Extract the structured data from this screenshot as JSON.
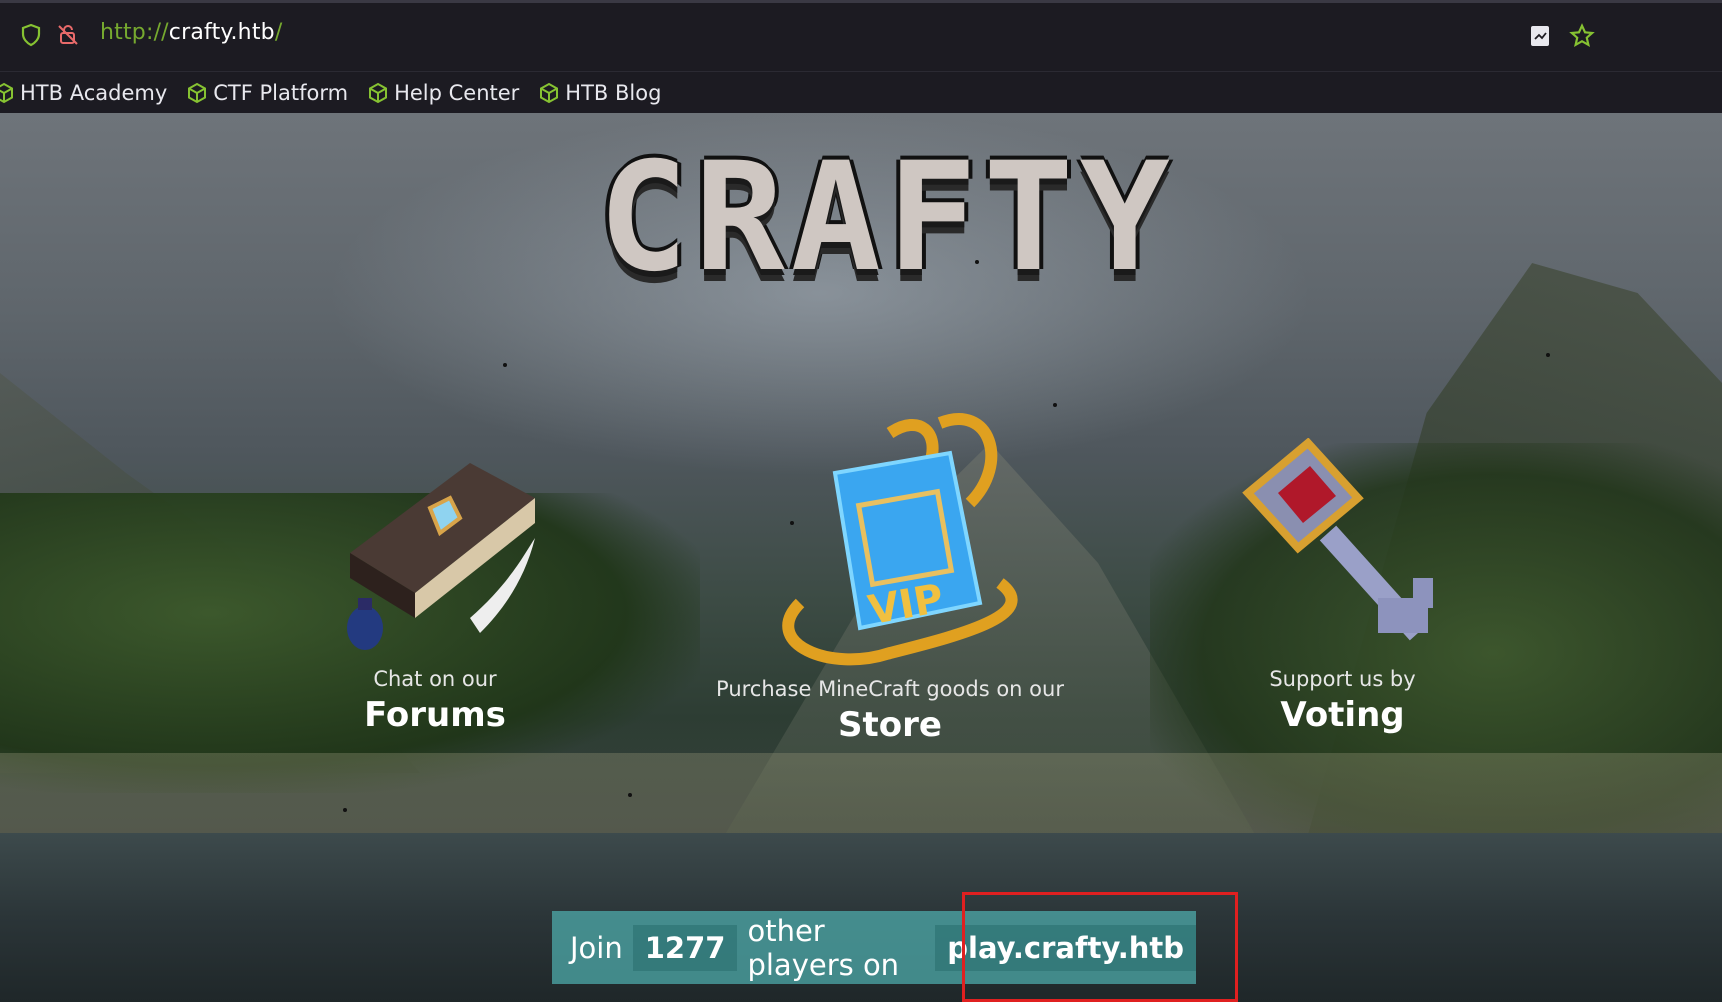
{
  "browser": {
    "url_protocol": "http://",
    "url_host": "crafty.htb",
    "url_suffix": "/",
    "bookmarks": [
      {
        "label": "HTB Academy",
        "icon": "cube-icon"
      },
      {
        "label": "CTF Platform",
        "icon": "cube-icon"
      },
      {
        "label": "Help Center",
        "icon": "cube-icon"
      },
      {
        "label": "HTB Blog",
        "icon": "cube-icon"
      }
    ],
    "accent_color": "#86c232"
  },
  "site": {
    "logo_text": "CRAFTY",
    "features": {
      "forums": {
        "sub": "Chat on our",
        "title": "Forums"
      },
      "store": {
        "sub": "Purchase MineCraft goods on our",
        "title": "Store"
      },
      "voting": {
        "sub": "Support us by",
        "title": "Voting"
      }
    },
    "join": {
      "prefix": "Join",
      "count": "1277",
      "middle": "other players on",
      "server": "play.crafty.htb"
    }
  }
}
